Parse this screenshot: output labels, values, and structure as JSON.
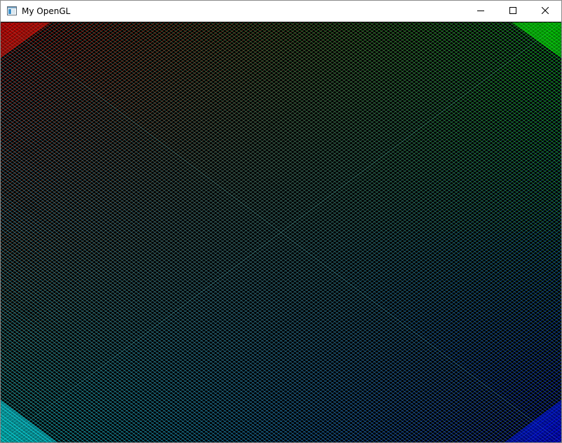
{
  "window": {
    "title": "My OpenGL",
    "icon": "app-window-icon",
    "controls": {
      "minimize_icon": "minimize-icon",
      "maximize_icon": "maximize-icon",
      "close_icon": "close-icon"
    }
  },
  "scene": {
    "background": "#000000",
    "corner_colors": {
      "top_left": "#ff0000",
      "top_right": "#00ff00",
      "bottom_left": "#00ffff",
      "bottom_right": "#0000ff"
    }
  }
}
